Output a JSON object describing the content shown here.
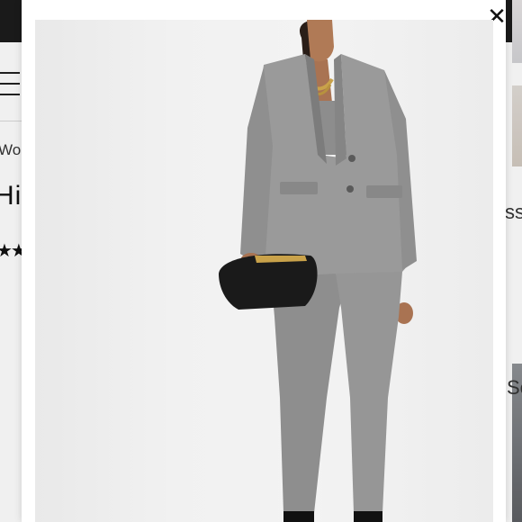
{
  "background_page": {
    "breadcrumb": "Won",
    "title": "Hi",
    "stars": "★★",
    "right_text_1": "ss",
    "right_text_2": "Se"
  },
  "modal": {
    "close_symbol": "✕",
    "close_icon": "close-icon"
  },
  "photo": {
    "subject": "model-in-gray-suit",
    "colors": {
      "backdrop": "#efefef",
      "suit": "#9a9a9a",
      "suit_shadow": "#7c7c7c",
      "clutch": "#1a1a1a",
      "skin": "#b07a56",
      "hair": "#2a1e18",
      "necklace": "#c9a24a"
    }
  }
}
